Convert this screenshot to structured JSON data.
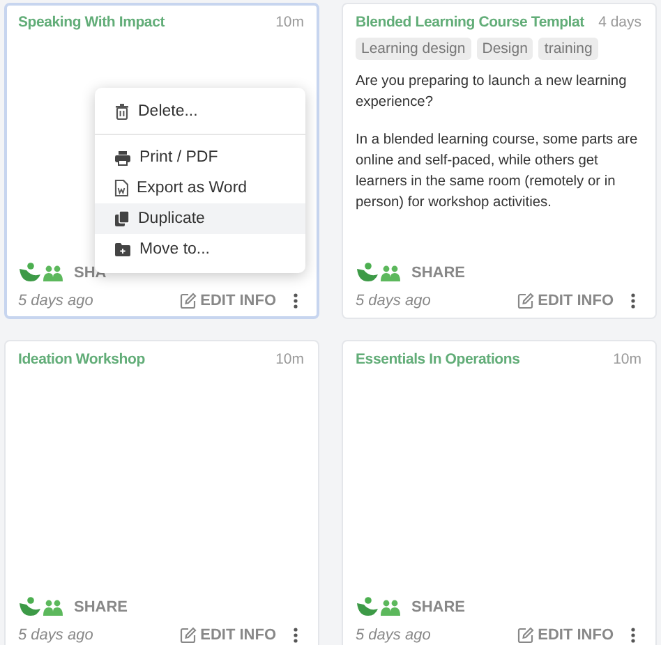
{
  "cards": [
    {
      "title": "Speaking With Impact",
      "duration": "10m",
      "selected": true,
      "share_label": "SHA",
      "date": "5 days ago",
      "edit_label": "EDIT INFO"
    },
    {
      "title": "Blended Learning Course Templat",
      "duration": "4 days",
      "selected": false,
      "tags": [
        "Learning design",
        "Design",
        "training"
      ],
      "description": [
        "Are you preparing to launch a new learning experience?",
        "In a blended learning course, some parts are online and self-paced, while others get learners in the same room (remotely or in person) for workshop activities."
      ],
      "share_label": "SHARE",
      "date": "5 days ago",
      "edit_label": "EDIT INFO"
    },
    {
      "title": "Ideation Workshop",
      "duration": "10m",
      "selected": false,
      "share_label": "SHARE",
      "date": "5 days ago",
      "edit_label": "EDIT INFO"
    },
    {
      "title": "Essentials In Operations",
      "duration": "10m",
      "selected": false,
      "share_label": "SHARE",
      "date": "5 days ago",
      "edit_label": "EDIT INFO"
    }
  ],
  "context_menu": {
    "groups": [
      [
        {
          "label": "Delete...",
          "highlighted": false
        }
      ],
      [
        {
          "label": "Print / PDF",
          "highlighted": false
        },
        {
          "label": "Export as Word",
          "highlighted": false
        },
        {
          "label": "Duplicate",
          "highlighted": true
        },
        {
          "label": "Move to...",
          "highlighted": false
        }
      ]
    ]
  }
}
